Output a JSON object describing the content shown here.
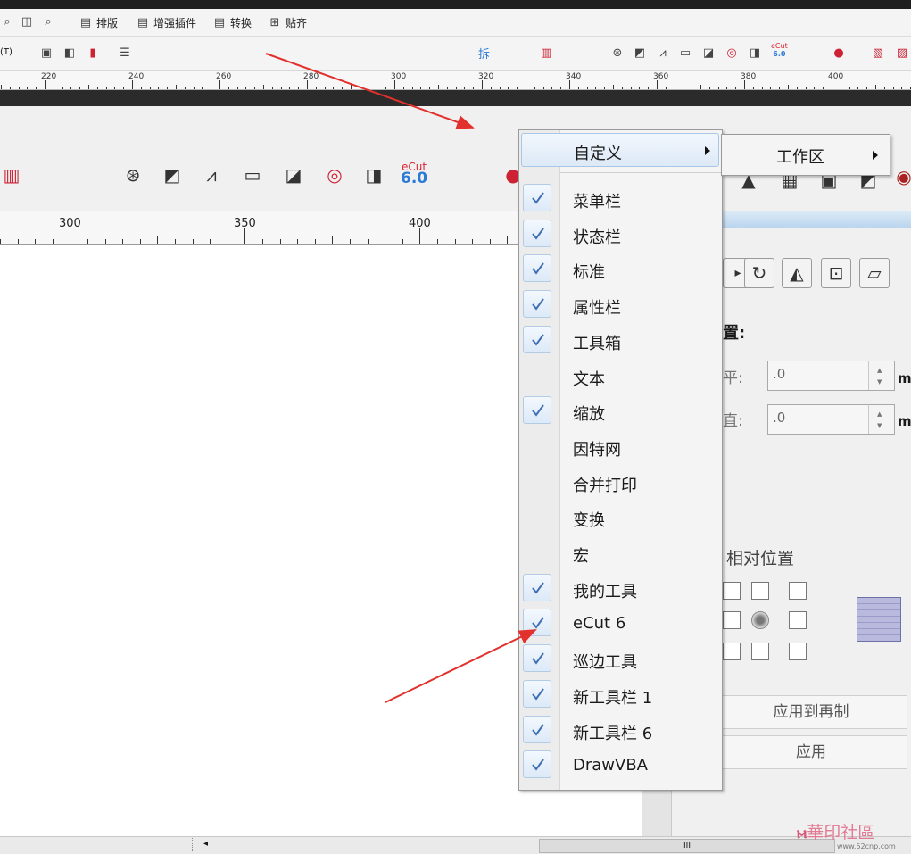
{
  "toolbar1": {
    "buttons": [
      "排版",
      "增强插件",
      "转换",
      "贴齐"
    ]
  },
  "toolbar2": {
    "item_t": "(T)",
    "label_chai": "拆"
  },
  "ruler_top": {
    "labels": [
      "220",
      "240",
      "260",
      "280",
      "300",
      "320",
      "340",
      "360",
      "380",
      "400"
    ]
  },
  "ruler_main": {
    "labels": [
      "300",
      "350",
      "400"
    ]
  },
  "ecut_icon": {
    "top": "eCut",
    "bottom": "6.0"
  },
  "context_menu": {
    "top_item": "自定义",
    "submenu_item": "工作区",
    "items": [
      {
        "label": "菜单栏",
        "checked": true
      },
      {
        "label": "状态栏",
        "checked": true
      },
      {
        "label": "标准",
        "checked": true
      },
      {
        "label": "属性栏",
        "checked": true
      },
      {
        "label": "工具箱",
        "checked": true
      },
      {
        "label": "文本",
        "checked": false
      },
      {
        "label": "缩放",
        "checked": true
      },
      {
        "label": "因特网",
        "checked": false
      },
      {
        "label": "合并打印",
        "checked": false
      },
      {
        "label": "变换",
        "checked": false
      },
      {
        "label": "宏",
        "checked": false
      },
      {
        "label": "我的工具",
        "checked": true
      },
      {
        "label": "eCut 6",
        "checked": true
      },
      {
        "label": "巡边工具",
        "checked": true
      },
      {
        "label": "新工具栏 1",
        "checked": true
      },
      {
        "label": "新工具栏 6",
        "checked": true
      },
      {
        "label": "DrawVBA",
        "checked": true
      }
    ]
  },
  "transform_panel": {
    "section_label": "置:",
    "h_label": "平:",
    "v_label": "直:",
    "h_value": ".0",
    "v_value": ".0",
    "unit": "m",
    "relative_position": "相对位置",
    "apply_to_copy": "应用到再制",
    "apply": "应用"
  },
  "watermark": {
    "text": "華印社區",
    "url": "www.52cnp.com"
  },
  "statusbar": {
    "scroll_marker": "III"
  }
}
